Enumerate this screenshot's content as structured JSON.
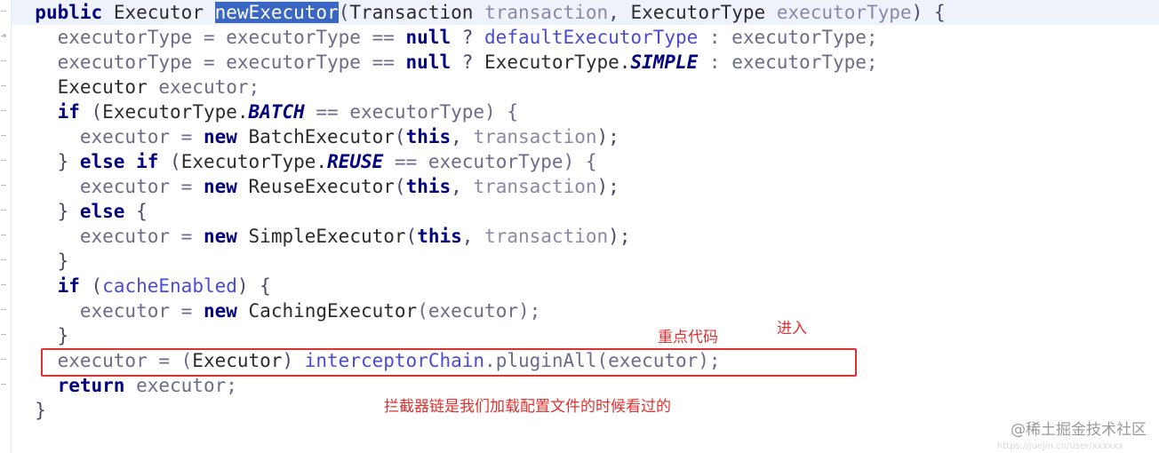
{
  "editor": {
    "language": "java",
    "selection_text": "newExecutor",
    "lines": [
      {
        "indent": 1,
        "tokens": [
          {
            "t": "public",
            "c": "kw"
          },
          {
            "t": " ",
            "c": "plain"
          },
          {
            "t": "Executor",
            "c": "type"
          },
          {
            "t": " ",
            "c": "plain"
          },
          {
            "t": "newExecutor",
            "c": "sel"
          },
          {
            "t": "(",
            "c": "punct"
          },
          {
            "t": "Transaction",
            "c": "type"
          },
          {
            "t": " ",
            "c": "plain"
          },
          {
            "t": "transaction",
            "c": "param"
          },
          {
            "t": ", ",
            "c": "punct"
          },
          {
            "t": "ExecutorType",
            "c": "type"
          },
          {
            "t": " ",
            "c": "plain"
          },
          {
            "t": "executorType",
            "c": "param"
          },
          {
            "t": ") {",
            "c": "punct"
          }
        ]
      },
      {
        "indent": 2,
        "tokens": [
          {
            "t": "executorType = executorType == ",
            "c": "ident"
          },
          {
            "t": "null",
            "c": "kw"
          },
          {
            "t": " ? ",
            "c": "punct"
          },
          {
            "t": "defaultExecutorType",
            "c": "field"
          },
          {
            "t": " : executorType;",
            "c": "ident"
          }
        ]
      },
      {
        "indent": 2,
        "tokens": [
          {
            "t": "executorType = executorType == ",
            "c": "ident"
          },
          {
            "t": "null",
            "c": "kw"
          },
          {
            "t": " ? ",
            "c": "punct"
          },
          {
            "t": "ExecutorType.",
            "c": "type"
          },
          {
            "t": "SIMPLE",
            "c": "static"
          },
          {
            "t": " : executorType;",
            "c": "ident"
          }
        ]
      },
      {
        "indent": 2,
        "tokens": [
          {
            "t": "Executor",
            "c": "type"
          },
          {
            "t": " executor;",
            "c": "ident"
          }
        ]
      },
      {
        "indent": 2,
        "tokens": [
          {
            "t": "if",
            "c": "kw"
          },
          {
            "t": " (",
            "c": "punct"
          },
          {
            "t": "ExecutorType.",
            "c": "type"
          },
          {
            "t": "BATCH",
            "c": "static"
          },
          {
            "t": " == executorType) {",
            "c": "ident"
          }
        ]
      },
      {
        "indent": 3,
        "tokens": [
          {
            "t": "executor = ",
            "c": "ident"
          },
          {
            "t": "new",
            "c": "kw"
          },
          {
            "t": " ",
            "c": "plain"
          },
          {
            "t": "BatchExecutor",
            "c": "type"
          },
          {
            "t": "(",
            "c": "punct"
          },
          {
            "t": "this",
            "c": "kw"
          },
          {
            "t": ", ",
            "c": "punct"
          },
          {
            "t": "transaction",
            "c": "param"
          },
          {
            "t": ");",
            "c": "punct"
          }
        ]
      },
      {
        "indent": 2,
        "tokens": [
          {
            "t": "} ",
            "c": "punct"
          },
          {
            "t": "else if",
            "c": "kw"
          },
          {
            "t": " (",
            "c": "punct"
          },
          {
            "t": "ExecutorType.",
            "c": "type"
          },
          {
            "t": "REUSE",
            "c": "static"
          },
          {
            "t": " == executorType) {",
            "c": "ident"
          }
        ]
      },
      {
        "indent": 3,
        "tokens": [
          {
            "t": "executor = ",
            "c": "ident"
          },
          {
            "t": "new",
            "c": "kw"
          },
          {
            "t": " ",
            "c": "plain"
          },
          {
            "t": "ReuseExecutor",
            "c": "type"
          },
          {
            "t": "(",
            "c": "punct"
          },
          {
            "t": "this",
            "c": "kw"
          },
          {
            "t": ", ",
            "c": "punct"
          },
          {
            "t": "transaction",
            "c": "param"
          },
          {
            "t": ");",
            "c": "punct"
          }
        ]
      },
      {
        "indent": 2,
        "tokens": [
          {
            "t": "} ",
            "c": "punct"
          },
          {
            "t": "else",
            "c": "kw"
          },
          {
            "t": " {",
            "c": "punct"
          }
        ]
      },
      {
        "indent": 3,
        "tokens": [
          {
            "t": "executor = ",
            "c": "ident"
          },
          {
            "t": "new",
            "c": "kw"
          },
          {
            "t": " ",
            "c": "plain"
          },
          {
            "t": "SimpleExecutor",
            "c": "type"
          },
          {
            "t": "(",
            "c": "punct"
          },
          {
            "t": "this",
            "c": "kw"
          },
          {
            "t": ", ",
            "c": "punct"
          },
          {
            "t": "transaction",
            "c": "param"
          },
          {
            "t": ");",
            "c": "punct"
          }
        ]
      },
      {
        "indent": 2,
        "tokens": [
          {
            "t": "}",
            "c": "punct"
          }
        ]
      },
      {
        "indent": 2,
        "tokens": [
          {
            "t": "if",
            "c": "kw"
          },
          {
            "t": " (",
            "c": "punct"
          },
          {
            "t": "cacheEnabled",
            "c": "field"
          },
          {
            "t": ") {",
            "c": "punct"
          }
        ]
      },
      {
        "indent": 3,
        "tokens": [
          {
            "t": "executor = ",
            "c": "ident"
          },
          {
            "t": "new",
            "c": "kw"
          },
          {
            "t": " ",
            "c": "plain"
          },
          {
            "t": "CachingExecutor",
            "c": "type"
          },
          {
            "t": "(executor);",
            "c": "ident"
          }
        ]
      },
      {
        "indent": 2,
        "tokens": [
          {
            "t": "}",
            "c": "punct"
          }
        ]
      },
      {
        "indent": 2,
        "tokens": [
          {
            "t": "executor = (",
            "c": "ident"
          },
          {
            "t": "Executor",
            "c": "type"
          },
          {
            "t": ") ",
            "c": "punct"
          },
          {
            "t": "interceptorChain",
            "c": "field"
          },
          {
            "t": ".pluginAll(executor);",
            "c": "ident"
          }
        ]
      },
      {
        "indent": 2,
        "tokens": [
          {
            "t": "return",
            "c": "kw"
          },
          {
            "t": " executor;",
            "c": "ident"
          }
        ]
      },
      {
        "indent": 1,
        "tokens": [
          {
            "t": "}",
            "c": "punct"
          }
        ]
      }
    ]
  },
  "annotations": {
    "note_key_code": "重点代码",
    "note_enter": "进入",
    "note_interceptor": "拦截器链是我们加载配置文件的时候看过的",
    "highlight_color": "#e03030"
  },
  "watermark": {
    "text": "@稀土掘金技术社区",
    "subtext": "https://juejin.cn/user/xxxxxx"
  }
}
